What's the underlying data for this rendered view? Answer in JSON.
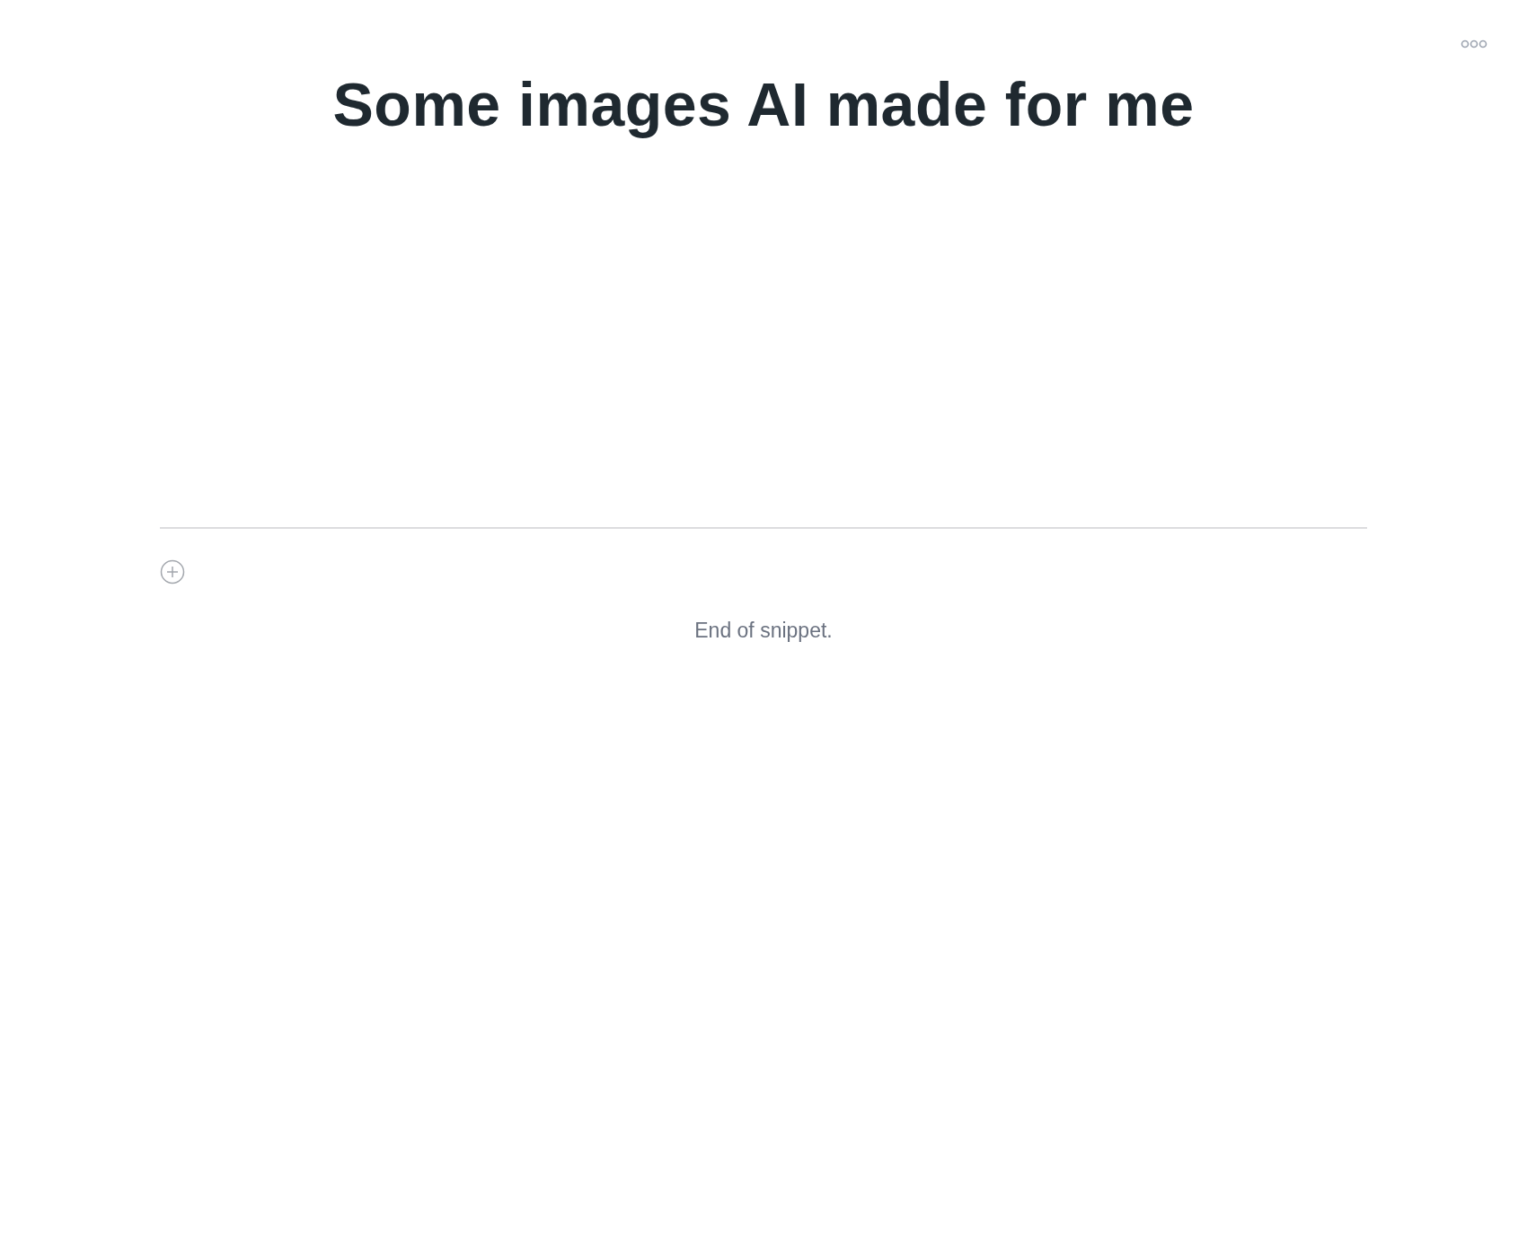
{
  "title": "Some images AI made for me",
  "footer": {
    "message": "End of snippet."
  }
}
